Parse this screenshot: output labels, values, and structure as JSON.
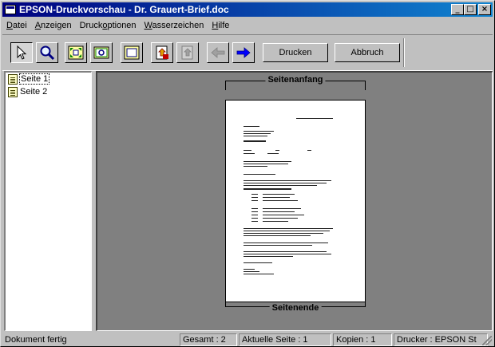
{
  "window": {
    "title": "EPSON-Druckvorschau - Dr. Grauert-Brief.doc",
    "controls": {
      "minimize": "_",
      "maximize": "□",
      "close": "×"
    }
  },
  "menubar": {
    "items": [
      {
        "label": "Datei",
        "accel": "D",
        "rest": "atei"
      },
      {
        "label": "Anzeigen",
        "accel": "A",
        "rest": "nzeigen"
      },
      {
        "label": "Druckoptionen",
        "pre": "Druck",
        "accel": "o",
        "rest": "ptionen"
      },
      {
        "label": "Wasserzeichen",
        "accel": "W",
        "rest": "asserzeichen"
      },
      {
        "label": "Hilfe",
        "accel": "H",
        "rest": "ilfe"
      }
    ]
  },
  "toolbar": {
    "icons": [
      {
        "name": "arrow-cursor-icon",
        "pressed": true
      },
      {
        "name": "magnifier-icon",
        "pressed": false
      },
      {
        "name": "fit-page-icon",
        "pressed": false
      },
      {
        "name": "zoom-page-icon",
        "pressed": false
      },
      {
        "name": "page-frame-icon",
        "pressed": false
      },
      {
        "name": "watermark-icon",
        "pressed": false
      },
      {
        "name": "watermark-disabled-icon",
        "pressed": false
      },
      {
        "name": "prev-page-arrow-icon",
        "pressed": false
      },
      {
        "name": "next-page-arrow-icon",
        "pressed": false
      }
    ],
    "print_label": "Drucken",
    "cancel_label": "Abbruch"
  },
  "pages": {
    "items": [
      {
        "label": "Seite 1",
        "selected": true
      },
      {
        "label": "Seite 2",
        "selected": false
      }
    ]
  },
  "preview": {
    "top_marker": "Seitenanfang",
    "bottom_marker": "Seitenende"
  },
  "statusbar": {
    "status": "Dokument fertig",
    "total": "Gesamt : 2",
    "current": "Aktuelle Seite : 1",
    "copies": "Kopien : 1",
    "printer": "Drucker : EPSON St"
  }
}
